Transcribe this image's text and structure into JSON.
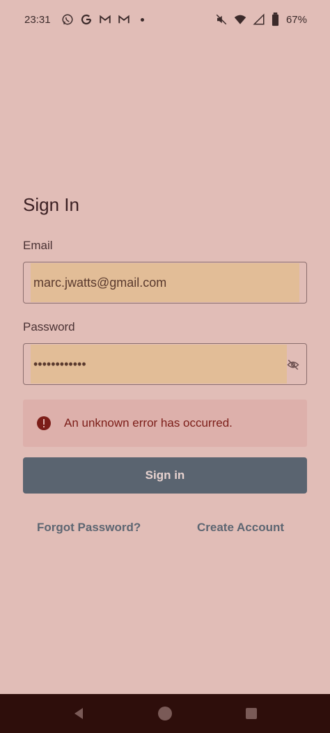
{
  "status": {
    "time": "23:31",
    "battery": "67%",
    "icons": [
      "whatsapp-icon",
      "google-icon",
      "gmail-icon",
      "gmail-icon",
      "notification-dot-icon",
      "mute-icon",
      "wifi-icon",
      "signal-icon",
      "battery-icon"
    ]
  },
  "form": {
    "title": "Sign In",
    "email_label": "Email",
    "email_value": "marc.jwatts@gmail.com",
    "password_label": "Password",
    "password_value": "••••••••••••",
    "error_text": "An unknown error has occurred.",
    "signin_label": "Sign in",
    "forgot_label": "Forgot Password?",
    "create_label": "Create Account"
  },
  "colors": {
    "background": "#e1bdb7",
    "autofill": "#e2bd97",
    "error_bg": "#ddb0ab",
    "error_text": "#7b1d18",
    "button": "#5a6470",
    "link": "#5d6672",
    "nav_bar": "#2e0e0b"
  },
  "nav": {
    "icons": [
      "back-icon",
      "home-icon",
      "recents-icon"
    ]
  }
}
